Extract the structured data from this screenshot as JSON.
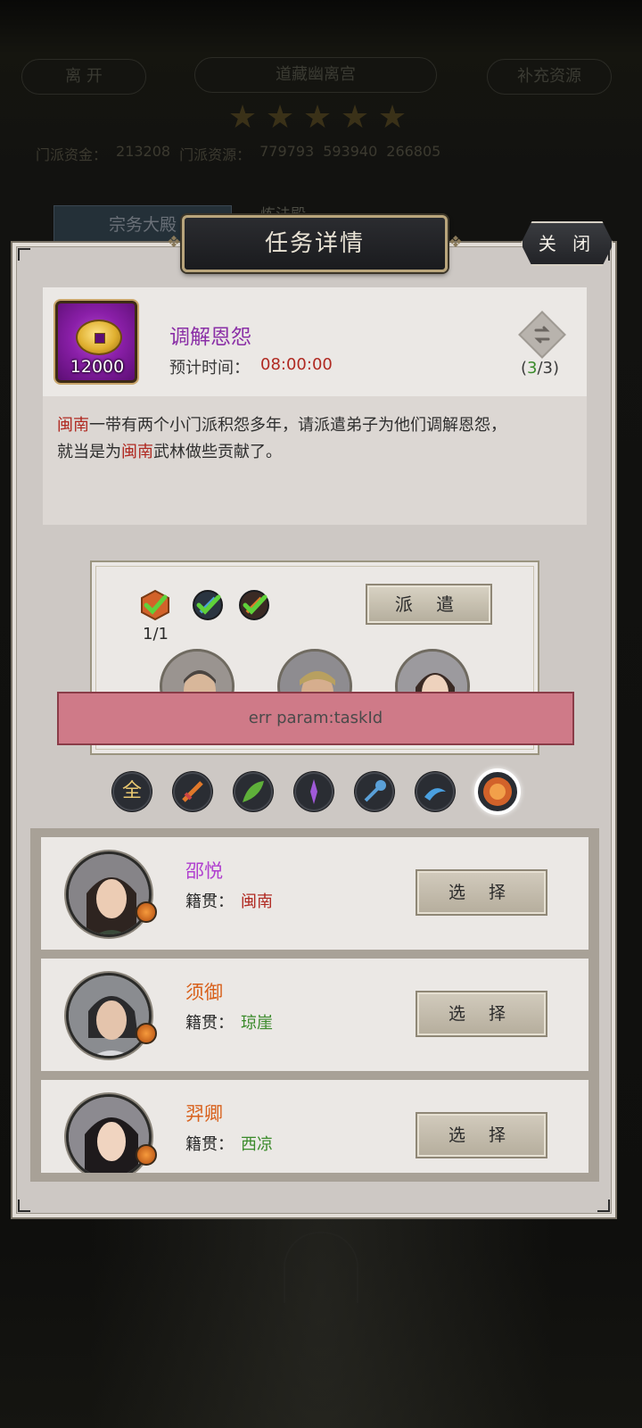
{
  "background": {
    "leave_label": "离 开",
    "location_label": "道藏幽离宫",
    "replenish_label": "补充资源",
    "star_count": 5,
    "stats": [
      "门派资金：",
      "213208",
      "门派资源：",
      "779793",
      "593940",
      "266805"
    ],
    "tab_hall": "宗务大殿",
    "tab_other": "炼法殿"
  },
  "modal": {
    "title": "任务详情",
    "close_label": "关 闭"
  },
  "task": {
    "reward_qty": "12000",
    "name": "调解恩怨",
    "time_label": "预计时间：",
    "time_value": "08:00:00",
    "refresh_open": "(",
    "refresh_current": "3",
    "refresh_rest": "/3)",
    "desc_line1_hl": "闽南",
    "desc_line1_rest": "一带有两个小门派积怨多年，请派遣弟子为他们调解恩怨，",
    "desc_line2_a": "就当是为",
    "desc_line2_hl": "闽南",
    "desc_line2_b": "武林做些贡献了。"
  },
  "dispatch": {
    "requirement_count": "1/1",
    "send_label": "派 遣"
  },
  "toast": {
    "message": "err param:taskId"
  },
  "filters": {
    "all_label": "全",
    "active_index": 6
  },
  "disciples": [
    {
      "name": "邵悦",
      "origin_label": "籍贯：",
      "origin": "闽南",
      "button": "选 择"
    },
    {
      "name": "须御",
      "origin_label": "籍贯：",
      "origin": "琼崖",
      "button": "选 择"
    },
    {
      "name": "羿卿",
      "origin_label": "籍贯：",
      "origin": "西凉",
      "button": "选 择"
    }
  ],
  "colors": {
    "name_purple": "#b03fcf",
    "name_orange": "#d8611c",
    "origin_red": "#b02a22",
    "origin_green": "#3a8a2a",
    "toast_bg": "#cf7a88"
  },
  "icons": {
    "reward": "gold-coin-icon",
    "refresh": "refresh-icon",
    "requirements": [
      "sect-badge-icon",
      "weapon-check-icon",
      "skill-check-icon"
    ],
    "filters": [
      "all-filter-icon",
      "blade-filter-icon",
      "leaf-filter-icon",
      "staff-filter-icon",
      "mace-filter-icon",
      "claw-filter-icon",
      "fist-filter-icon"
    ]
  }
}
